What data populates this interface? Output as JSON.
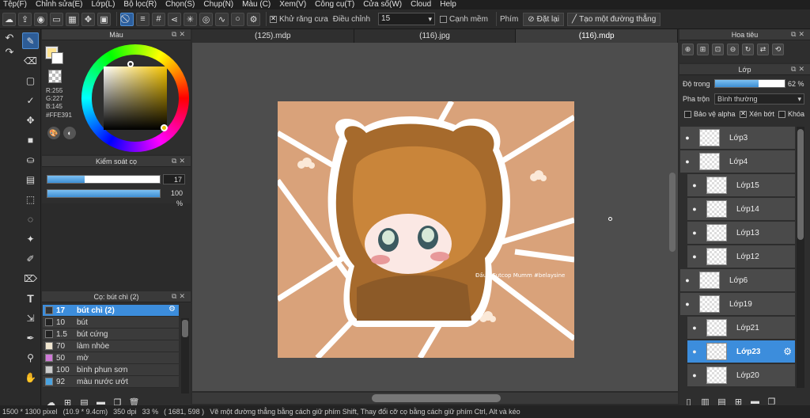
{
  "menu": [
    "Tệp(F)",
    "Chỉnh sửa(E)",
    "Lớp(L)",
    "Bộ lọc(R)",
    "Chọn(S)",
    "Chụp(N)",
    "Màu (C)",
    "Xem(V)",
    "Công cụ(T)",
    "Cửa sổ(W)",
    "Cloud",
    "Help"
  ],
  "toolbar": {
    "antialias_label": "Khử răng cưa",
    "adjust_label": "Điều chỉnh",
    "adjust_value": "15",
    "edge_label": "Cạnh mềm",
    "key_label": "Phím",
    "reset_label": "Đặt lại",
    "create_line_label": "Tạo một đường thẳng"
  },
  "color_panel": {
    "title": "Màu",
    "rgb_r": "R:255",
    "rgb_g": "G:227",
    "rgb_b": "B:145",
    "hex": "#FFE391",
    "fg_color": "#ffe391"
  },
  "brush_control": {
    "title": "Kiểm soát cọ",
    "size_value": "17",
    "opacity_value": "100 %",
    "size_fraction": 0.33,
    "opacity_fraction": 1.0
  },
  "brush_panel": {
    "title": "Cọ: bút chì (2)",
    "items": [
      {
        "num": "17",
        "label": "bút chì (2)",
        "color": "#333333",
        "active": true
      },
      {
        "num": "10",
        "label": "bút",
        "color": "#222222"
      },
      {
        "num": "1.5",
        "label": "bút cứng",
        "color": "#222222"
      },
      {
        "num": "70",
        "label": "làm nhòe",
        "color": "#f0e6d0"
      },
      {
        "num": "50",
        "label": "mờ",
        "color": "#d07ad8"
      },
      {
        "num": "100",
        "label": "bình phun sơn",
        "color": "#cccccc"
      },
      {
        "num": "92",
        "label": "màu nước ướt",
        "color": "#4aa3e0"
      }
    ]
  },
  "tabs": [
    "(125).mdp",
    "(116).jpg",
    "(116).mdp"
  ],
  "active_tab": 2,
  "artwork": {
    "signature_text": "Đấu · Cutcop Mumm #belaysine"
  },
  "navigator": {
    "title": "Hoa tiêu"
  },
  "layer_panel": {
    "title": "Lớp",
    "opacity_label": "Độ trong",
    "opacity_value": "62 %",
    "opacity_fraction": 0.62,
    "blend_label": "Pha trộn",
    "blend_value": "Bình thường",
    "protect_alpha": "Bảo vệ alpha",
    "clipping": "Xén bớt",
    "lock": "Khóa",
    "layers": [
      {
        "name": "Lớp3",
        "child": false
      },
      {
        "name": "Lớp4",
        "child": false
      },
      {
        "name": "Lớp15",
        "child": true
      },
      {
        "name": "Lớp14",
        "child": true
      },
      {
        "name": "Lớp13",
        "child": true
      },
      {
        "name": "Lớp12",
        "child": true
      },
      {
        "name": "Lớp6",
        "child": false
      },
      {
        "name": "Lớp19",
        "child": false
      },
      {
        "name": "Lớp21",
        "child": true
      },
      {
        "name": "Lớp23",
        "child": true,
        "active": true
      },
      {
        "name": "Lớp20",
        "child": true
      }
    ]
  },
  "status": {
    "size": "1500 * 1300 pixel",
    "physical": "(10.9 * 9.4cm)",
    "dpi": "350 dpi",
    "zoom": "33 %",
    "coords": "( 1681, 598 )",
    "hint": "Vẽ một đường thẳng bằng cách giữ phím Shift, Thay đổi cỡ cọ bằng cách giữ phím Ctrl, Alt và kéo"
  }
}
